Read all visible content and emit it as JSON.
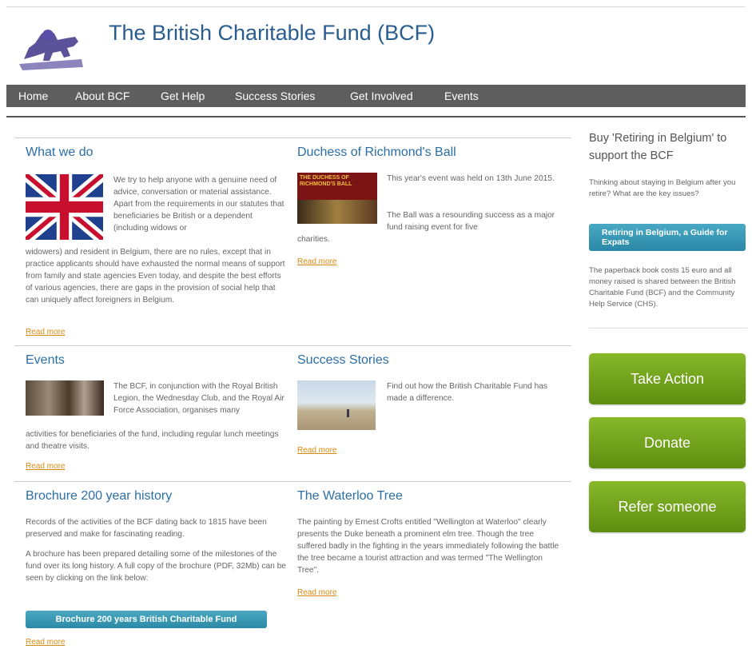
{
  "header": {
    "title": "The British Charitable Fund (BCF)"
  },
  "nav": [
    "Home",
    "About BCF",
    "Get Help",
    "Success Stories",
    "Get Involved",
    "Events"
  ],
  "cards": {
    "what_we_do": {
      "title": "What we do",
      "text_right": "We try to help anyone with a genuine need of advice, conversation or material assistance. Apart from the requirements in our statutes that beneficiaries be British or a dependent (including widows or",
      "text_full": "widowers) and resident in Belgium, there are no rules, except that in practice applicants should have exhausted the normal means of support from family and state agencies Even today, and despite the best efforts of various agencies, there are gaps in the provision of social help that can uniquely affect foreigners in Belgium.",
      "read_more": "Read more"
    },
    "ball": {
      "title": "Duchess of Richmond's Ball",
      "text1": "This year's event was held on 13th June 2015.",
      "text2": "The Ball was a resounding success as a major fund raising event for five",
      "text_full": "charities.",
      "read_more": "Read more",
      "thumb_text": "THE DUCHESS OF RICHMOND'S BALL"
    },
    "events": {
      "title": "Events",
      "text_right": "The BCF, in conjunction with the Royal British Legion, the Wednesday Club, and the Royal Air Force Association, organises many",
      "text_full": "activities for beneficiaries of the fund, including regular lunch meetings and theatre visits.",
      "read_more": "Read more"
    },
    "success": {
      "title": "Success Stories",
      "text_right": "Find out how the British Charitable Fund has made a difference.",
      "read_more": "Read more"
    },
    "brochure": {
      "title": "Brochure 200 year history",
      "text1": "Records of the activities of the BCF dating back to 1815 have been preserved and make for fascinating reading.",
      "text2": "A brochure has been prepared detailing some of the milestones of the fund over its long history.  A full copy of the brochure (PDF, 32Mb) can be seen by clicking on the link below:",
      "button": "Brochure 200 years British Charitable Fund",
      "read_more": "Read more"
    },
    "waterloo": {
      "title": "The Waterloo Tree",
      "text": "The painting by Ernest Crofts entitled \"Wellington at Waterloo\" clearly presents the Duke beneath a prominent elm tree. Though the tree suffered badly in the fighting in the years immediately following the battle the tree became a tourist attraction and was termed \"The Wellington Tree\".",
      "read_more": "Read more"
    }
  },
  "sidebar": {
    "heading": "Buy 'Retiring in Belgium' to support the BCF",
    "intro": "Thinking about staying in Belgium after you retire? What are the key issues?",
    "book_button": "Retiring in Belgium, a Guide for Expats",
    "details": "The paperback book costs 15 euro and all money raised is shared between the British Charitable Fund (BCF) and the Community Help Service (CHS).",
    "buttons": [
      "Take Action",
      "Donate",
      "Refer someone"
    ]
  },
  "colors": {
    "link": "#2a6ea8",
    "nav_bg": "#5e5e5e",
    "green": "#6f9f1c",
    "read_more": "#d98a12"
  }
}
